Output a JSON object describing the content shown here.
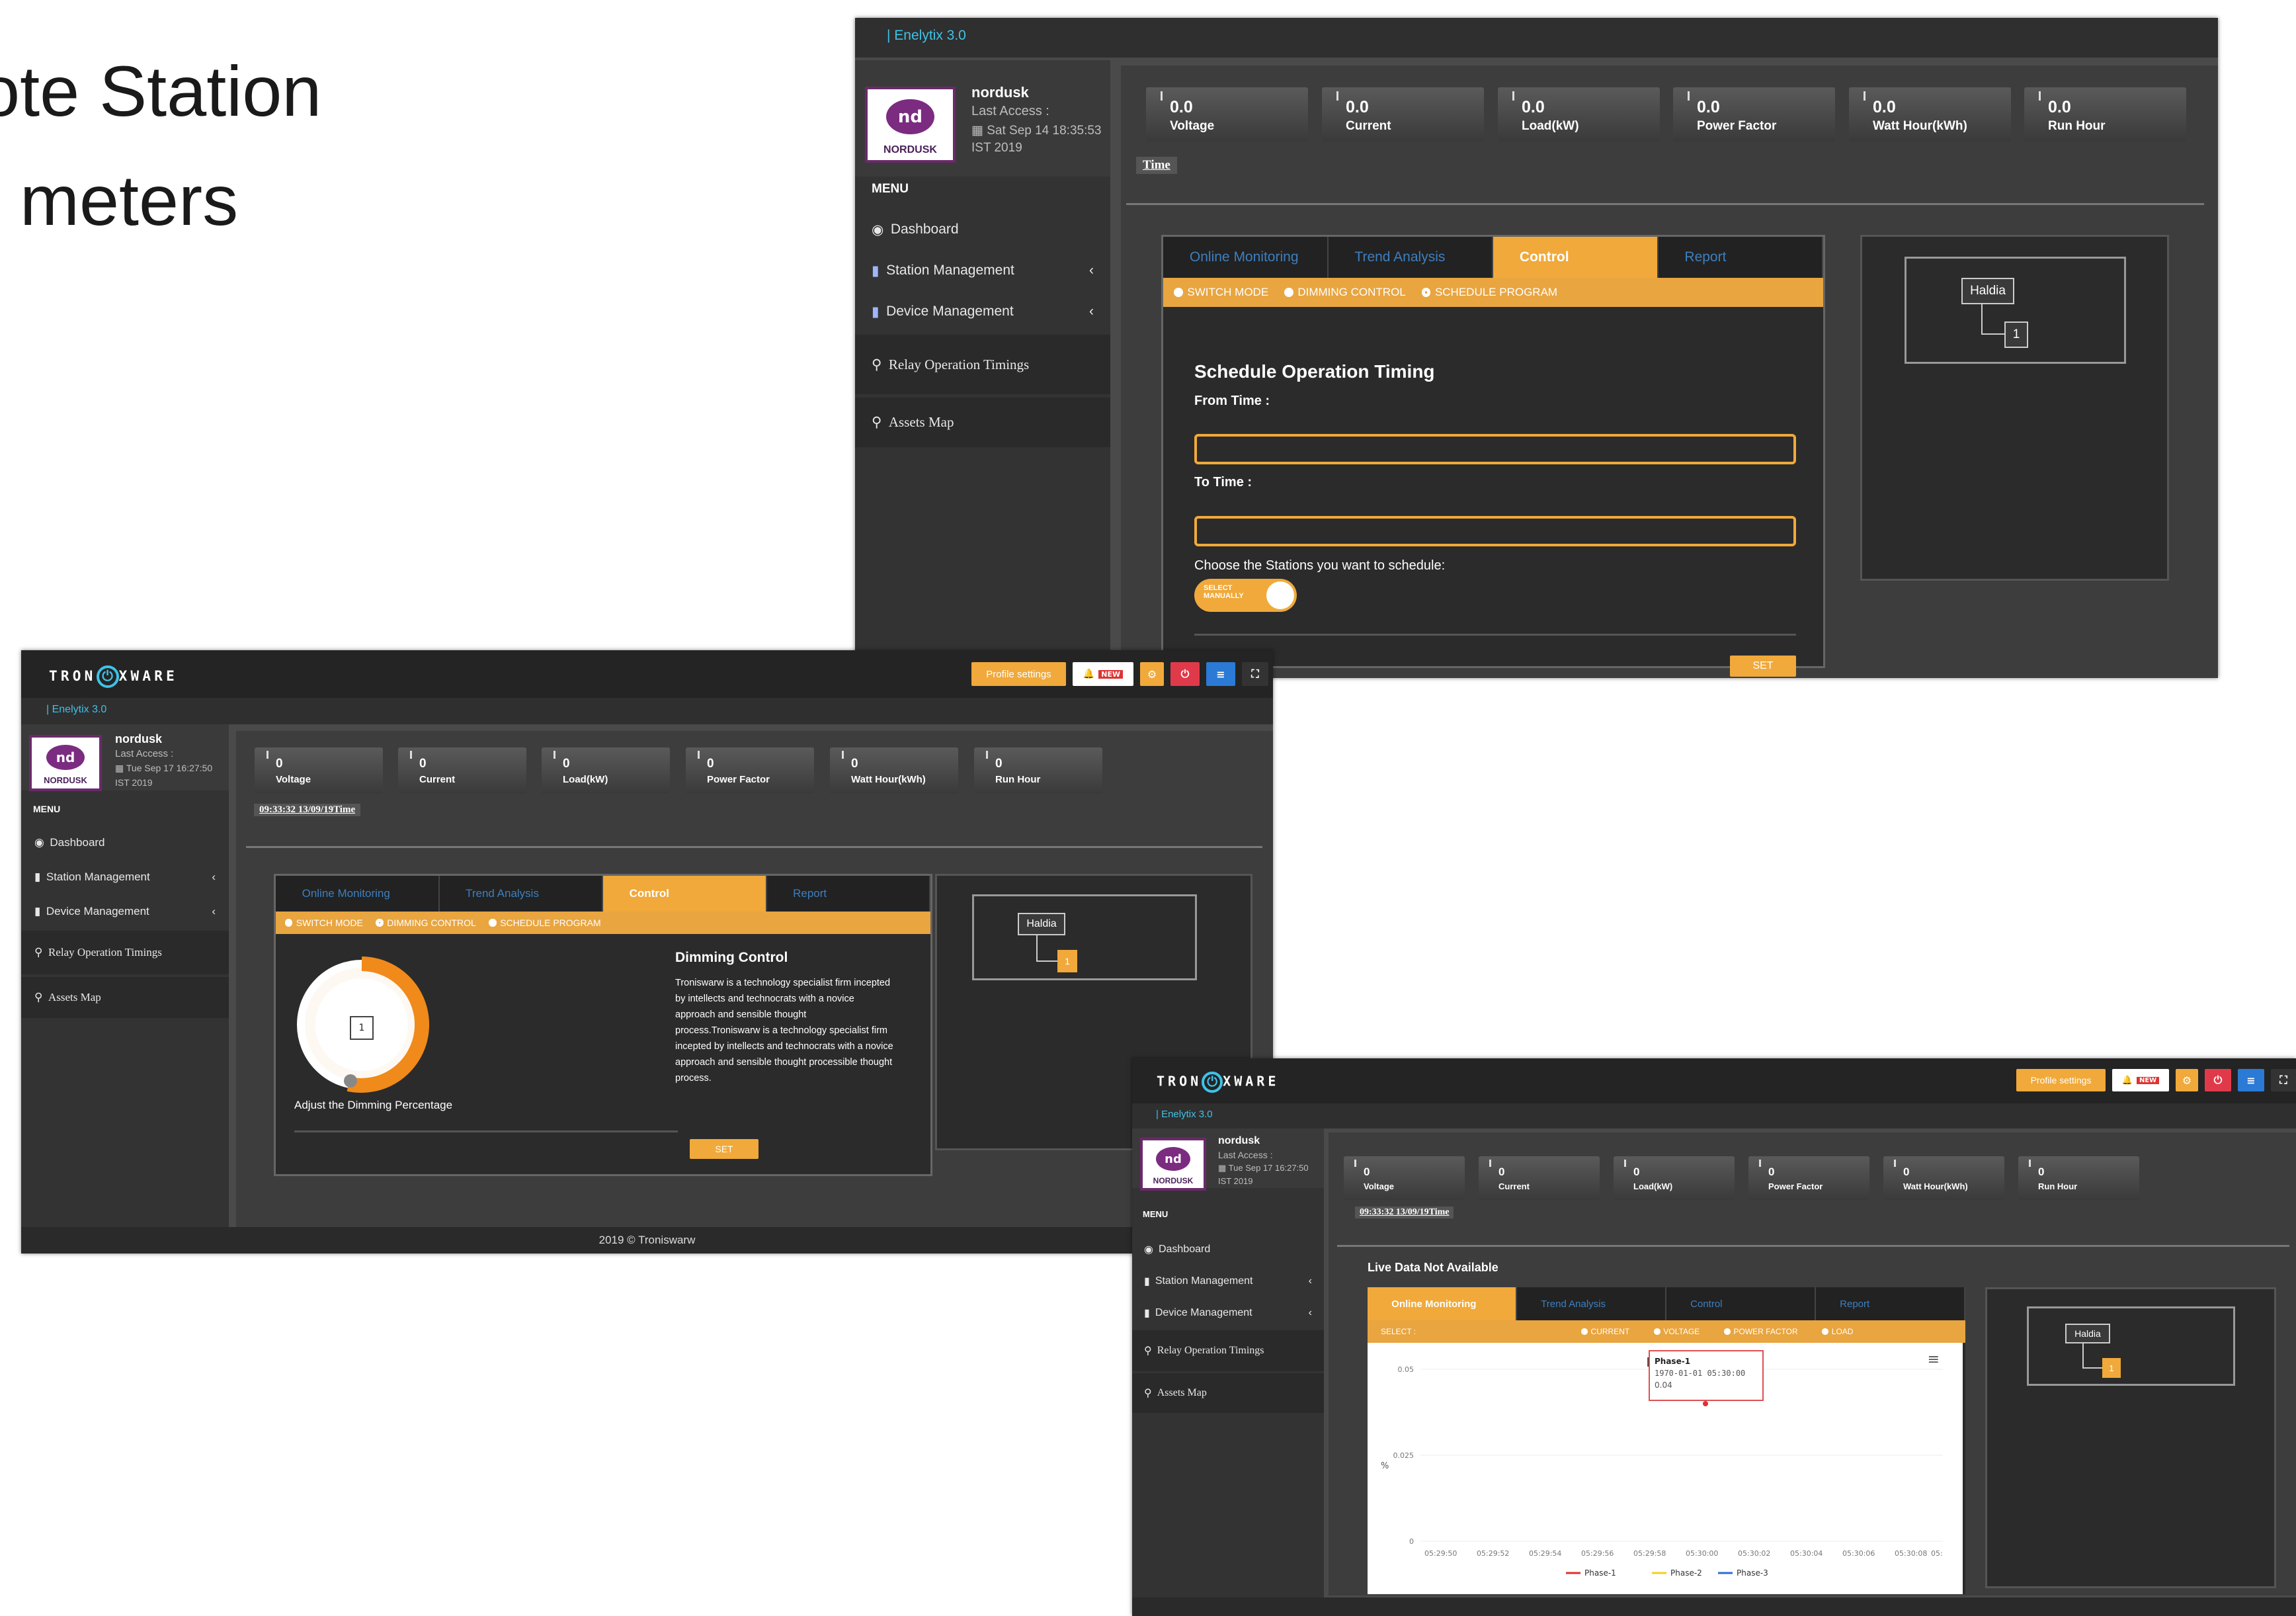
{
  "slide": {
    "title_line1": "ote Station",
    "title_line2": "/ meters"
  },
  "brand": {
    "product": "| Enelytix 3.0",
    "company": "TRONXWARE",
    "logo_text": "NORDUSK"
  },
  "user": {
    "name": "nordusk",
    "last_access_label": "Last Access :"
  },
  "menu": {
    "header": "MENU",
    "items": [
      "Dashboard",
      "Station Management",
      "Device Management",
      "Relay Operation Timings",
      "Assets Map"
    ]
  },
  "topbar": {
    "profile_settings": "Profile settings",
    "notification_badge": "NEW"
  },
  "tabs": [
    "Online Monitoring",
    "Trend Analysis",
    "Control",
    "Report"
  ],
  "control_modes": [
    "SWITCH MODE",
    "DIMMING CONTROL",
    "SCHEDULE PROGRAM"
  ],
  "tree": {
    "root": "Haldia",
    "child": "1"
  },
  "screen1": {
    "last_access": "Sat Sep 14 18:35:53",
    "tz": "IST 2019",
    "metrics": [
      {
        "value": "0.0",
        "label": "Voltage"
      },
      {
        "value": "0.0",
        "label": "Current"
      },
      {
        "value": "0.0",
        "label": "Load(kW)"
      },
      {
        "value": "0.0",
        "label": "Power Factor"
      },
      {
        "value": "0.0",
        "label": "Watt Hour(kWh)"
      },
      {
        "value": "0.0",
        "label": "Run Hour"
      }
    ],
    "time_label": "Time",
    "schedule_title": "Schedule Operation Timing",
    "from_label": "From Time :",
    "to_label": "To Time :",
    "choose_label": "Choose the Stations you want to schedule:",
    "toggle_label": "SELECT MANUALLY",
    "set": "SET"
  },
  "screen2": {
    "last_access": "Tue Sep 17 16:27:50",
    "tz": "IST 2019",
    "metrics": [
      {
        "value": "0",
        "label": "Voltage"
      },
      {
        "value": "0",
        "label": "Current"
      },
      {
        "value": "0",
        "label": "Load(kW)"
      },
      {
        "value": "0",
        "label": "Power Factor"
      },
      {
        "value": "0",
        "label": "Watt Hour(kWh)"
      },
      {
        "value": "0",
        "label": "Run Hour"
      }
    ],
    "time_label": "09:33:32 13/09/19Time",
    "dimming_value": "1",
    "adjust_label": "Adjust the Dimming Percentage",
    "dimming_title": "Dimming Control",
    "dimming_desc": "Troniswarw is a technology specialist firm incepted by intellects and technocrats with a novice approach and sensible thought process.Troniswarw is a technology specialist firm incepted by intellects and technocrats with a novice approach and sensible thought processible thought process.",
    "set": "SET",
    "footer": "2019 © Troniswarw"
  },
  "screen3": {
    "last_access": "Tue Sep 17 16:27:50",
    "tz": "IST 2019",
    "metrics": [
      {
        "value": "0",
        "label": "Voltage"
      },
      {
        "value": "0",
        "label": "Current"
      },
      {
        "value": "0",
        "label": "Load(kW)"
      },
      {
        "value": "0",
        "label": "Power Factor"
      },
      {
        "value": "0",
        "label": "Watt Hour(kWh)"
      },
      {
        "value": "0",
        "label": "Run Hour"
      }
    ],
    "time_label": "09:33:32 13/09/19Time",
    "live_status": "Live Data Not Available",
    "select_label": "SELECT :",
    "select_options": [
      "CURRENT",
      "VOLTAGE",
      "POWER FACTOR",
      "LOAD"
    ]
  },
  "chart_data": {
    "type": "line",
    "title": "Live",
    "ylabel": "%",
    "ylim": [
      0,
      0.05
    ],
    "yticks": [
      "0.05",
      "0.025",
      "0"
    ],
    "categories": [
      "05:29:50",
      "05:29:52",
      "05:29:54",
      "05:29:56",
      "05:29:58",
      "05:30:00",
      "05:30:02",
      "05:30:04",
      "05:30:06",
      "05:30:08"
    ],
    "x_overflow_label": "05:",
    "series": [
      {
        "name": "Phase-1",
        "color": "#e03030",
        "values": [
          null,
          null,
          null,
          null,
          null,
          0.04,
          null,
          null,
          null,
          null
        ]
      },
      {
        "name": "Phase-2",
        "color": "#f0d020",
        "values": []
      },
      {
        "name": "Phase-3",
        "color": "#2a6fd0",
        "values": []
      }
    ],
    "tooltip": {
      "series": "Phase-1",
      "time": "1970-01-01 05:30:00",
      "value": "0.04"
    },
    "legend_position": "bottom"
  }
}
